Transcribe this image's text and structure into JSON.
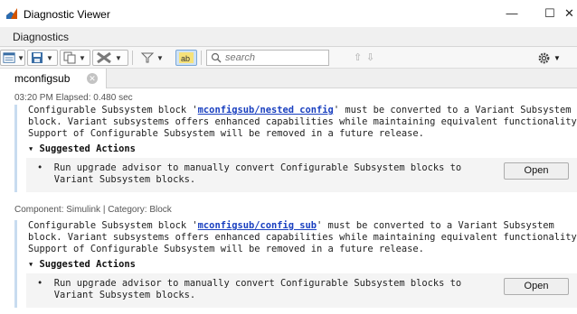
{
  "window": {
    "title": "Diagnostic Viewer",
    "minimize": "—",
    "maximize": "☐",
    "close": "✕"
  },
  "ribbon": {
    "tab": "Diagnostics"
  },
  "toolbar": {
    "search_placeholder": "search",
    "prev_arrow": "⇧",
    "next_arrow": "⇩"
  },
  "report_tab": {
    "label": "mconfigsub",
    "close_glyph": "✕"
  },
  "report": {
    "header": "03:20 PM  Elapsed: 0.480 sec",
    "messages": [
      {
        "pre_link": "Configurable Subsystem block '",
        "link": "mconfigsub/nested config",
        "post_link": "' must be converted to a Variant Subsystem",
        "line2": "block. Variant subsystems offers enhanced capabilities while maintaining equivalent functionality.",
        "line3": "Support of Configurable Subsystem will be removed in a future release.",
        "suggest_head": "▾ Suggested Actions",
        "action_line1": "•  Run upgrade advisor to manually convert Configurable Subsystem blocks to",
        "action_line2": "   Variant Subsystem blocks.",
        "button": "Open",
        "component": "Component:  Simulink | Category:  Block"
      },
      {
        "pre_link": "Configurable Subsystem block '",
        "link": "mconfigsub/config sub",
        "post_link": "' must be converted to a Variant Subsystem",
        "line2": "block. Variant subsystems offers enhanced capabilities while maintaining equivalent functionality.",
        "line3": "Support of Configurable Subsystem will be removed in a future release.",
        "suggest_head": "▾ Suggested Actions",
        "action_line1": "•  Run upgrade advisor to manually convert Configurable Subsystem blocks to",
        "action_line2": "   Variant Subsystem blocks.",
        "button": "Open"
      }
    ]
  },
  "colors": {
    "link": "#1a40c0",
    "message_bar": "#c8dcf0",
    "suggest_bg": "#f4f4f4"
  }
}
